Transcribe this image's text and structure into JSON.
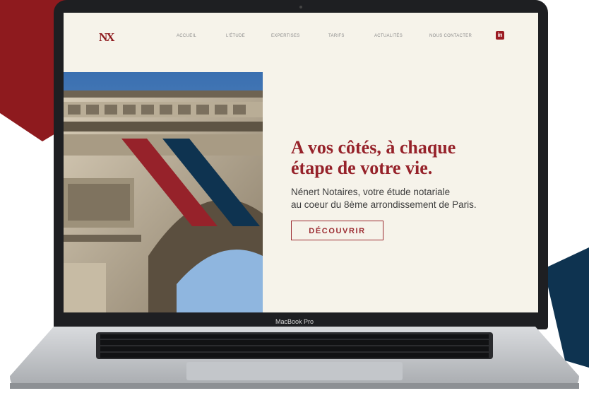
{
  "site": {
    "logo_text": "NX",
    "nav": [
      "ACCUEIL",
      "L'ÉTUDE",
      "EXPERTISES",
      "TARIFS",
      "ACTUALITÉS",
      "NOUS CONTACTER"
    ],
    "linkedin_icon": "linkedin-icon",
    "linkedin_glyph": "in"
  },
  "hero": {
    "headline_line1": "A vos côtés, à chaque",
    "headline_line2": "étape de votre vie.",
    "sub_line1": "Nénert Notaires, votre étude notariale",
    "sub_line2": "au coeur du 8ème arrondissement de Paris.",
    "cta_label": "DÉCOUVRIR"
  },
  "device": {
    "label": "MacBook Pro"
  },
  "colors": {
    "brand_red": "#96222a",
    "brand_navy": "#0e3350",
    "page_bg": "#f6f3ea"
  }
}
